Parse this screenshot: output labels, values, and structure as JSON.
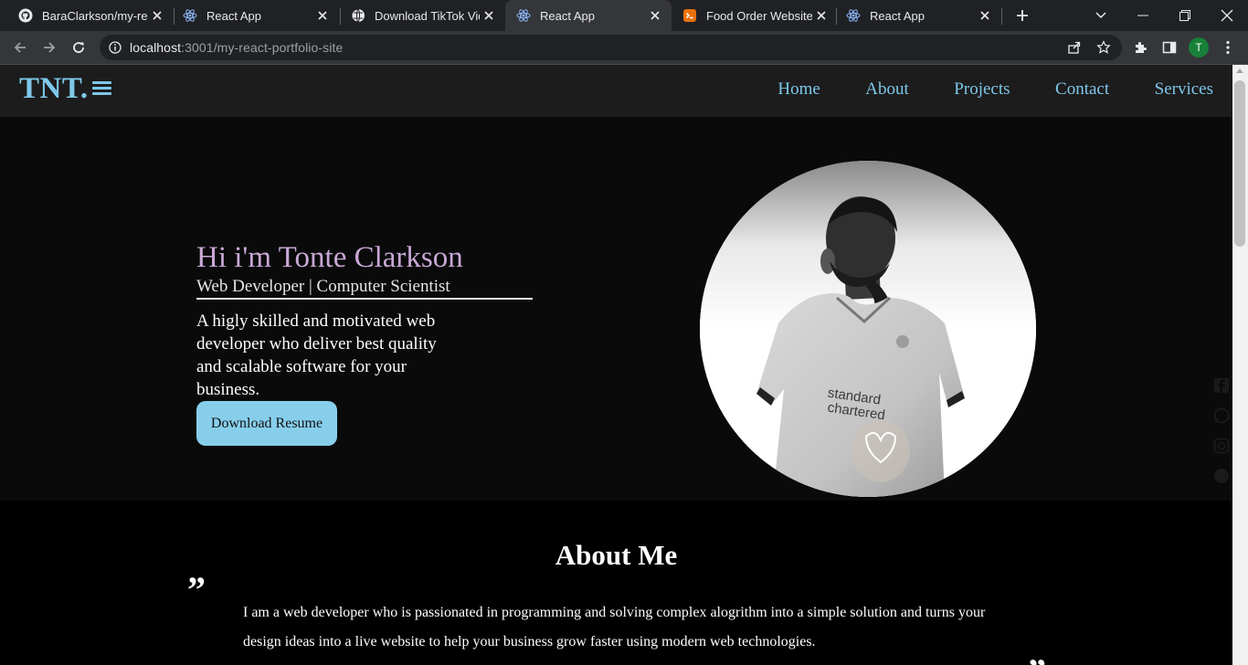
{
  "browser": {
    "tabs": [
      {
        "title": "BaraClarkson/my-reac",
        "icon": "github-icon"
      },
      {
        "title": "React App",
        "icon": "react-icon"
      },
      {
        "title": "Download TikTok Vide",
        "icon": "globe-icon"
      },
      {
        "title": "React App",
        "icon": "react-icon",
        "active": true
      },
      {
        "title": "Food Order Website -",
        "icon": "html-icon"
      },
      {
        "title": "React App",
        "icon": "react-icon"
      }
    ],
    "url_host": "localhost",
    "url_path": ":3001/my-react-portfolio-site",
    "profile_initial": "T"
  },
  "navbar": {
    "logo": "TNT.",
    "links": [
      "Home",
      "About",
      "Projects",
      "Contact",
      "Services"
    ]
  },
  "hero": {
    "name": "Hi i'm Tonte Clarkson",
    "role": "Web Developer | Computer Scientist",
    "description": "A higly skilled and motivated web developer who deliver best quality and scalable software for your business.",
    "button": "Download Resume",
    "shirt_text_1": "standard",
    "shirt_text_2": "chartered"
  },
  "about": {
    "title": "About Me",
    "text": "I am a web developer who is passionated in programming and solving complex alogrithm into a simple solution and turns your design ideas into a live website to help your business grow faster using modern web technologies."
  },
  "colors": {
    "accent": "#7ec8e9",
    "button_bg": "#87ceeb",
    "name_color": "#c9a8d6",
    "nav_bg": "#1c1c1c"
  }
}
